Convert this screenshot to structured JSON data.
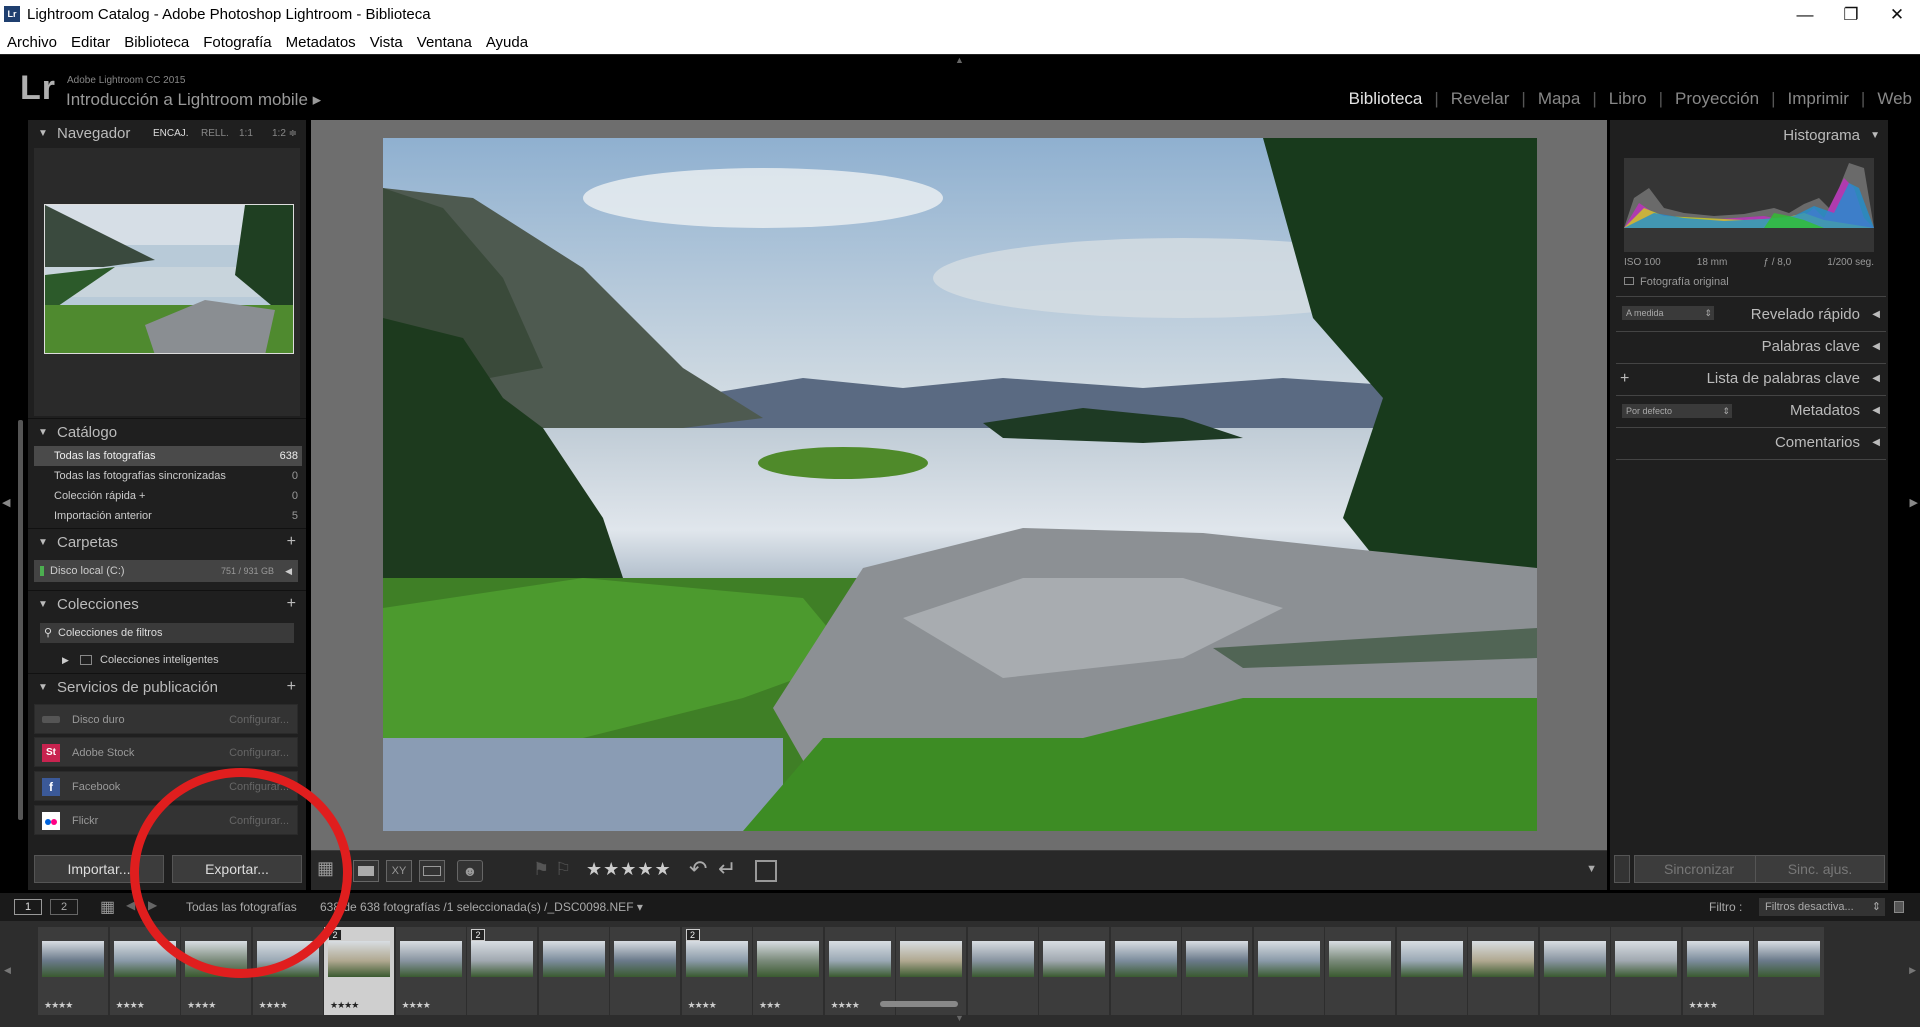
{
  "window": {
    "title": "Lightroom Catalog - Adobe Photoshop Lightroom - Biblioteca",
    "app_icon": "Lr"
  },
  "menu": [
    "Archivo",
    "Editar",
    "Biblioteca",
    "Fotografía",
    "Metadatos",
    "Vista",
    "Ventana",
    "Ayuda"
  ],
  "identity": {
    "logo": "Lr",
    "subtitle": "Adobe Lightroom CC 2015",
    "catalog": "Introducción a Lightroom mobile ▸"
  },
  "modules": [
    "Biblioteca",
    "Revelar",
    "Mapa",
    "Libro",
    "Proyección",
    "Imprimir",
    "Web"
  ],
  "active_module": "Biblioteca",
  "navigator": {
    "title": "Navegador",
    "zoom": [
      "ENCAJ.",
      "RELL.",
      "1:1",
      "1:2 ≑"
    ]
  },
  "catalog": {
    "title": "Catálogo",
    "rows": [
      {
        "label": "Todas las fotografías",
        "count": "638"
      },
      {
        "label": "Todas las fotografías sincronizadas",
        "count": "0"
      },
      {
        "label": "Colección rápida +",
        "count": "0"
      },
      {
        "label": "Importación anterior",
        "count": "5"
      }
    ]
  },
  "folders": {
    "title": "Carpetas",
    "disk": "Disco local (C:)",
    "disk_usage": "751 / 931 GB"
  },
  "collections": {
    "title": "Colecciones",
    "filter": "Colecciones de filtros",
    "smart": "Colecciones inteligentes"
  },
  "publish": {
    "title": "Servicios de publicación",
    "services": [
      {
        "label": "Disco duro",
        "config": "Configurar...",
        "icon": "hard-drive-icon",
        "color": "#555555"
      },
      {
        "label": "Adobe Stock",
        "config": "Configurar...",
        "icon": "St",
        "color": "#c8234f"
      },
      {
        "label": "Facebook",
        "config": "Configurar...",
        "icon": "f",
        "color": "#3b5998"
      },
      {
        "label": "Flickr",
        "config": "Configurar...",
        "icon": "flickr-icon",
        "color": "#ffffff"
      }
    ]
  },
  "buttons": {
    "import": "Importar...",
    "export": "Exportar...",
    "sync": "Sincronizar",
    "sync_settings": "Sinc. ajus."
  },
  "right": {
    "histogram": "Histograma",
    "exif": [
      "ISO 100",
      "18 mm",
      "ƒ / 8,0",
      "1/200 seg."
    ],
    "original": "Fotografía original",
    "quick": "Revelado rápido",
    "quick_preset": "A medida",
    "keywords": "Palabras clave",
    "keyword_list": "Lista de palabras clave",
    "metadata": "Metadatos",
    "metadata_preset": "Por defecto",
    "comments": "Comentarios"
  },
  "toolbar": {
    "stars": "★★★★★"
  },
  "filmhdr": {
    "page1": "1",
    "page2": "2",
    "source": "Todas las fotografías",
    "status": "638 de 638 fotografías /1 seleccionada(s) /_DSC0098.NEF ▾",
    "filter_label": "Filtro :",
    "filter_value": "Filtros desactiva..."
  },
  "annotation": {
    "circle_color": "#e01e1e"
  },
  "filmstrip": [
    {
      "stars": "★★★★",
      "badge": ""
    },
    {
      "stars": "★★★★",
      "badge": ""
    },
    {
      "stars": "★★★★",
      "badge": ""
    },
    {
      "stars": "★★★★",
      "badge": ""
    },
    {
      "stars": "★★★★",
      "badge": "2"
    },
    {
      "stars": "★★★★",
      "badge": ""
    },
    {
      "stars": "",
      "badge": "2"
    },
    {
      "stars": "",
      "badge": ""
    },
    {
      "stars": "",
      "badge": ""
    },
    {
      "stars": "★★★★",
      "badge": "2"
    },
    {
      "stars": "★★★",
      "badge": ""
    },
    {
      "stars": "★★★★",
      "badge": ""
    },
    {
      "stars": "",
      "badge": ""
    },
    {
      "stars": "",
      "badge": ""
    },
    {
      "stars": "",
      "badge": ""
    },
    {
      "stars": "",
      "badge": ""
    },
    {
      "stars": "",
      "badge": ""
    },
    {
      "stars": "",
      "badge": ""
    },
    {
      "stars": "",
      "badge": ""
    },
    {
      "stars": "",
      "badge": ""
    },
    {
      "stars": "",
      "badge": ""
    },
    {
      "stars": "",
      "badge": ""
    },
    {
      "stars": "",
      "badge": ""
    },
    {
      "stars": "★★★★",
      "badge": ""
    },
    {
      "stars": "",
      "badge": ""
    }
  ]
}
